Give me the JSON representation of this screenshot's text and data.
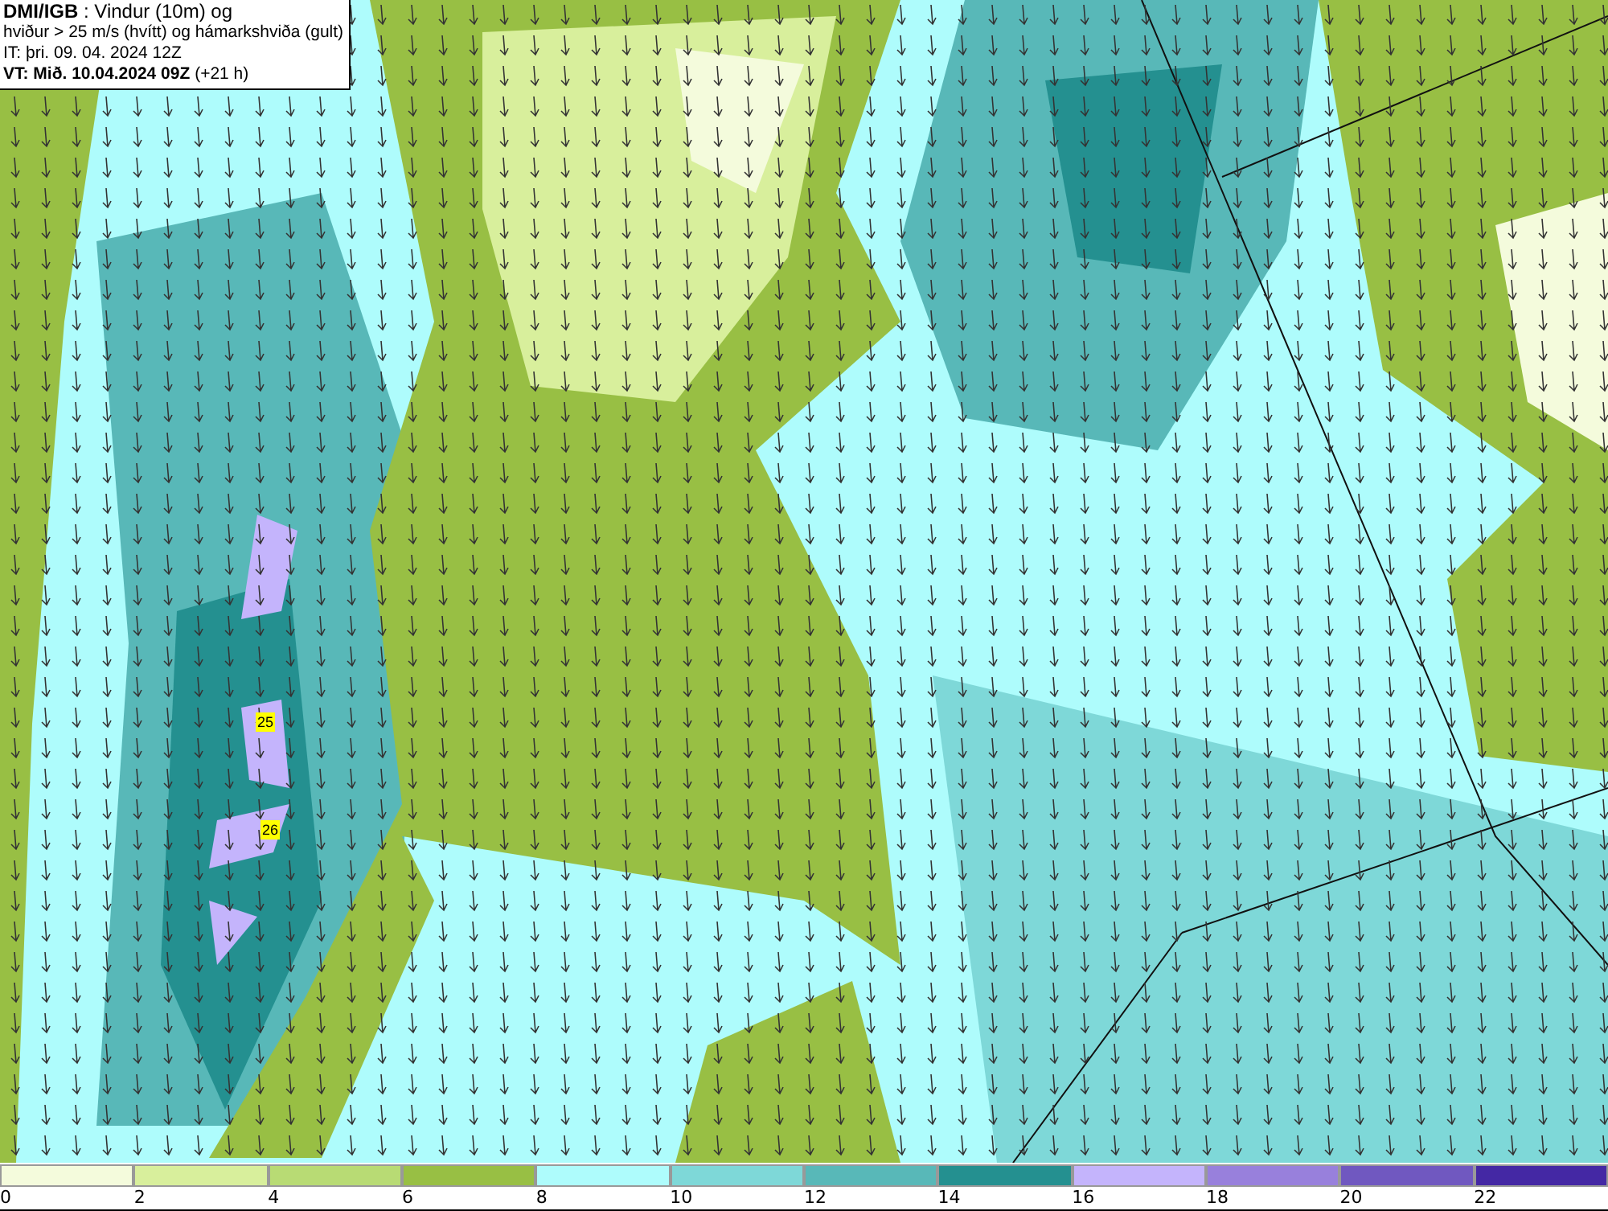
{
  "header": {
    "lines": [
      "**DMI/IGB** : Vindur (10m) og",
      "hviður > 25 m/s (hvítt) og hámarkshviða (gult)",
      "IT: þri. 09. 04. 2024 12Z",
      "**VT: Mið. 10.04.2024 09Z** (+21 h)"
    ]
  },
  "map": {
    "gust_labels": [
      "25",
      "26"
    ]
  },
  "legend": {
    "bins": [
      {
        "label": "0",
        "color": "#f4fbdc"
      },
      {
        "label": "2",
        "color": "#d8ef9c"
      },
      {
        "label": "4",
        "color": "#b8db74"
      },
      {
        "label": "6",
        "color": "#98bf44"
      },
      {
        "label": "8",
        "color": "#aefcfc"
      },
      {
        "label": "10",
        "color": "#7ed8d8"
      },
      {
        "label": "12",
        "color": "#58b8b8"
      },
      {
        "label": "14",
        "color": "#249090"
      },
      {
        "label": "16",
        "color": "#c4b4fc"
      },
      {
        "label": "18",
        "color": "#9880dc"
      },
      {
        "label": "20",
        "color": "#7058c0"
      },
      {
        "label": "22",
        "color": "#4428a4"
      }
    ]
  }
}
